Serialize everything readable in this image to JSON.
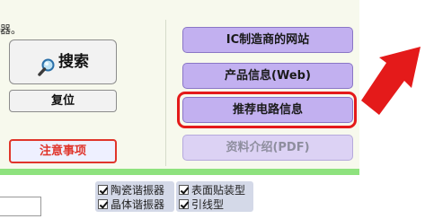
{
  "top_text": "器。",
  "left_panel": {
    "search_label": "搜索",
    "reset_label": "复位",
    "notice_label": "注意事项"
  },
  "right_panel": {
    "ic_maker_site_label": "IC制造商的网站",
    "product_info_label": "产品信息(Web)",
    "recommended_circuit_label": "推荐电路信息",
    "datasheet_label": "资料介绍(PDF)"
  },
  "filters": {
    "group1": [
      {
        "label": "陶瓷谐振器",
        "checked": true
      },
      {
        "label": "晶体谐振器",
        "checked": true
      }
    ],
    "group2": [
      {
        "label": "表面贴装型",
        "checked": true
      },
      {
        "label": "引线型",
        "checked": true
      }
    ]
  },
  "colors": {
    "panel_bg": "#f7f9ed",
    "purple_button": "#c2b0f0",
    "highlight_red": "#e41a1a",
    "green_strip": "#8ee27e"
  },
  "icons": {
    "search": "magnifier-icon",
    "pointer": "red-arrow-icon"
  }
}
